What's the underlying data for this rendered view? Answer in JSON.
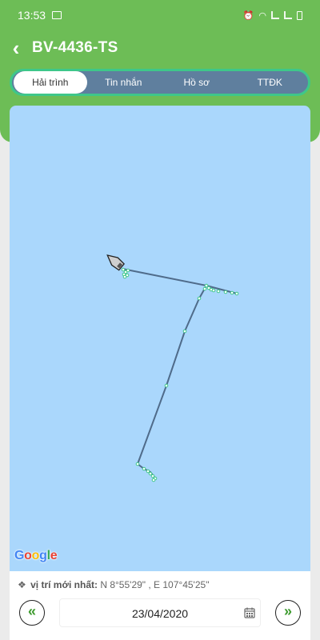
{
  "status_bar": {
    "time": "13:53"
  },
  "header": {
    "title": "BV-4436-TS",
    "back_icon": "chevron-left-icon"
  },
  "tabs": [
    {
      "label": "Hải trình",
      "active": true
    },
    {
      "label": "Tin nhắn",
      "active": false
    },
    {
      "label": "Hồ sơ",
      "active": false
    },
    {
      "label": "TTĐK",
      "active": false
    }
  ],
  "map": {
    "provider_logo": "Google",
    "colors": {
      "water": "#aad7fc",
      "track": "#4f6b8a",
      "point": "#3ec78a"
    }
  },
  "info": {
    "last_position_label": "vị trí mới nhất:",
    "last_position_value": "N 8°55'29\" , E 107°45'25\""
  },
  "date_nav": {
    "prev_label": "«",
    "next_label": "»",
    "date": "23/04/2020",
    "calendar_icon": "calendar-icon"
  },
  "colors": {
    "header_green": "#6dbd56",
    "tab_bar": "#5f7f9e",
    "tab_border": "#3ec78a",
    "nav_arrow": "#3e9b2f"
  }
}
